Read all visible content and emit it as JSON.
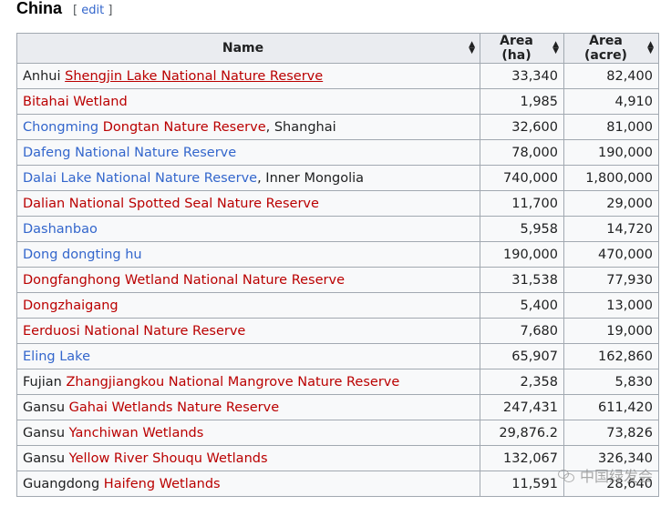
{
  "section": {
    "title": "China",
    "edit_open": "[",
    "edit_label": "edit",
    "edit_close": "]"
  },
  "table": {
    "headers": [
      "Name",
      "Area (ha)",
      "Area (acre)"
    ],
    "rows": [
      {
        "parts": [
          {
            "t": "Anhui ",
            "c": "plain"
          },
          {
            "t": "Shengjin Lake National Nature Reserve",
            "c": "red ul"
          }
        ],
        "ha": "33,340",
        "acre": "82,400"
      },
      {
        "parts": [
          {
            "t": "Bitahai Wetland",
            "c": "red"
          }
        ],
        "ha": "1,985",
        "acre": "4,910"
      },
      {
        "parts": [
          {
            "t": "Chongming",
            "c": "blue"
          },
          {
            "t": " ",
            "c": "plain"
          },
          {
            "t": "Dongtan Nature Reserve",
            "c": "red"
          },
          {
            "t": ", Shanghai",
            "c": "plain"
          }
        ],
        "ha": "32,600",
        "acre": "81,000"
      },
      {
        "parts": [
          {
            "t": "Dafeng National Nature Reserve",
            "c": "blue"
          }
        ],
        "ha": "78,000",
        "acre": "190,000"
      },
      {
        "parts": [
          {
            "t": "Dalai Lake National Nature Reserve",
            "c": "blue"
          },
          {
            "t": ", Inner Mongolia",
            "c": "plain"
          }
        ],
        "ha": "740,000",
        "acre": "1,800,000"
      },
      {
        "parts": [
          {
            "t": "Dalian National Spotted Seal Nature Reserve",
            "c": "red"
          }
        ],
        "ha": "11,700",
        "acre": "29,000"
      },
      {
        "parts": [
          {
            "t": "Dashanbao",
            "c": "blue"
          }
        ],
        "ha": "5,958",
        "acre": "14,720"
      },
      {
        "parts": [
          {
            "t": "Dong dongting hu",
            "c": "blue"
          }
        ],
        "ha": "190,000",
        "acre": "470,000"
      },
      {
        "parts": [
          {
            "t": "Dongfanghong Wetland National Nature Reserve",
            "c": "red"
          }
        ],
        "ha": "31,538",
        "acre": "77,930"
      },
      {
        "parts": [
          {
            "t": "Dongzhaigang",
            "c": "red"
          }
        ],
        "ha": "5,400",
        "acre": "13,000"
      },
      {
        "parts": [
          {
            "t": "Eerduosi National Nature Reserve",
            "c": "red"
          }
        ],
        "ha": "7,680",
        "acre": "19,000"
      },
      {
        "parts": [
          {
            "t": "Eling Lake",
            "c": "blue"
          }
        ],
        "ha": "65,907",
        "acre": "162,860"
      },
      {
        "parts": [
          {
            "t": "Fujian ",
            "c": "plain"
          },
          {
            "t": "Zhangjiangkou National Mangrove Nature Reserve",
            "c": "red"
          }
        ],
        "ha": "2,358",
        "acre": "5,830"
      },
      {
        "parts": [
          {
            "t": "Gansu ",
            "c": "plain"
          },
          {
            "t": "Gahai Wetlands Nature Reserve",
            "c": "red"
          }
        ],
        "ha": "247,431",
        "acre": "611,420"
      },
      {
        "parts": [
          {
            "t": "Gansu ",
            "c": "plain"
          },
          {
            "t": "Yanchiwan Wetlands",
            "c": "red"
          }
        ],
        "ha": "29,876.2",
        "acre": "73,826"
      },
      {
        "parts": [
          {
            "t": "Gansu ",
            "c": "plain"
          },
          {
            "t": "Yellow River Shouqu Wetlands",
            "c": "red"
          }
        ],
        "ha": "132,067",
        "acre": "326,340"
      },
      {
        "parts": [
          {
            "t": "Guangdong ",
            "c": "plain"
          },
          {
            "t": "Haifeng Wetlands",
            "c": "red"
          }
        ],
        "ha": "11,591",
        "acre": "28,640"
      }
    ]
  },
  "watermark": {
    "text": "中国绿发会"
  },
  "colors": {
    "link_blue": "#3366cc",
    "link_red": "#ba0000",
    "header_bg": "#eaecf0",
    "border": "#a2a9b1"
  }
}
